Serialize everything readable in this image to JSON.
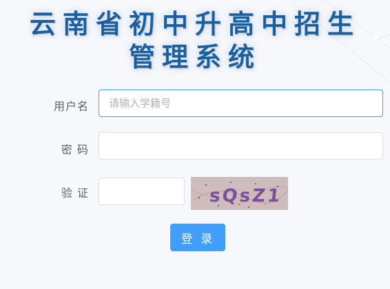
{
  "header": {
    "title_line1": "云南省初中升高中招生",
    "title_line2": "管理系统"
  },
  "form": {
    "username_label": "用户名",
    "username_placeholder": "请输入学籍号",
    "username_value": "",
    "password_label": "密 码",
    "password_value": "",
    "captcha_label": "验 证",
    "captcha_value": "",
    "captcha_image_text": "sQsZ1",
    "login_label": "登 录"
  },
  "colors": {
    "title": "#1b5f9e",
    "primary": "#409eff",
    "background": "#f7f8fb",
    "captcha_bg": "#cfbcbc"
  }
}
